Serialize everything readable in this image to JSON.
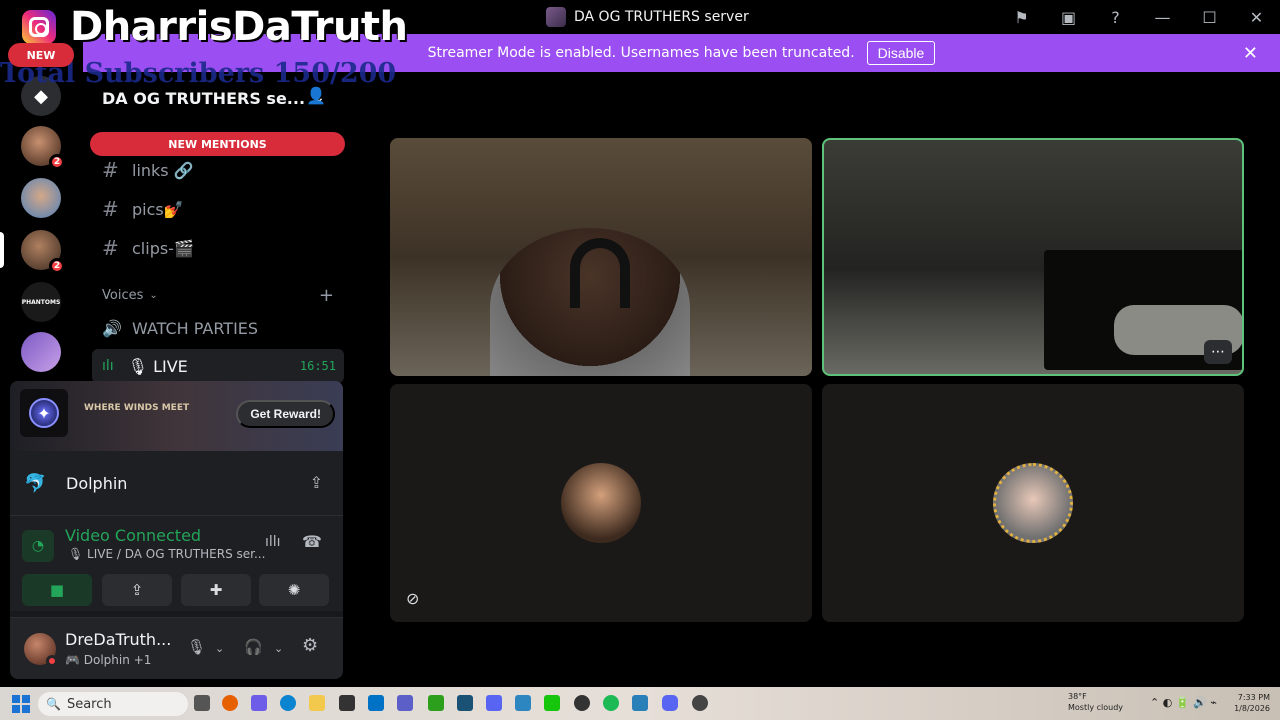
{
  "overlay": {
    "brand_name": "DharrisDaTruth",
    "new_label": "NEW",
    "subscribers": "Total Subscribers 150/200"
  },
  "titlebar": {
    "server_title": "DA OG TRUTHERS server"
  },
  "banner": {
    "message": "Streamer Mode is enabled. Usernames have been truncated.",
    "disable_label": "Disable"
  },
  "rail": {
    "badges": [
      "2",
      "2"
    ]
  },
  "sidebar": {
    "guild_name": "DA OG TRUTHERS se...",
    "new_mentions": "NEW MENTIONS",
    "channels": [
      {
        "name": "links 🔗"
      },
      {
        "name": "pics💅"
      },
      {
        "name": "clips-🎬"
      }
    ],
    "category": "Voices",
    "watch_parties": "WATCH PARTIES",
    "live_channel": "🎙 LIVE",
    "live_timer": "16:51"
  },
  "panel": {
    "game_logo": "WHERE WINDS MEET",
    "reward_label": "Get Reward!",
    "activity_name": "Dolphin",
    "voice_status": "Video Connected",
    "voice_channel": "🎙 LIVE / DA OG TRUTHERS ser...",
    "username": "DreDaTruth...",
    "user_activity": "🎮 Dolphin +1"
  },
  "taskbar": {
    "search_label": "Search",
    "weather_temp": "38°F",
    "weather_desc": "Mostly cloudy",
    "time": "7:33 PM",
    "date": "1/8/2026"
  }
}
